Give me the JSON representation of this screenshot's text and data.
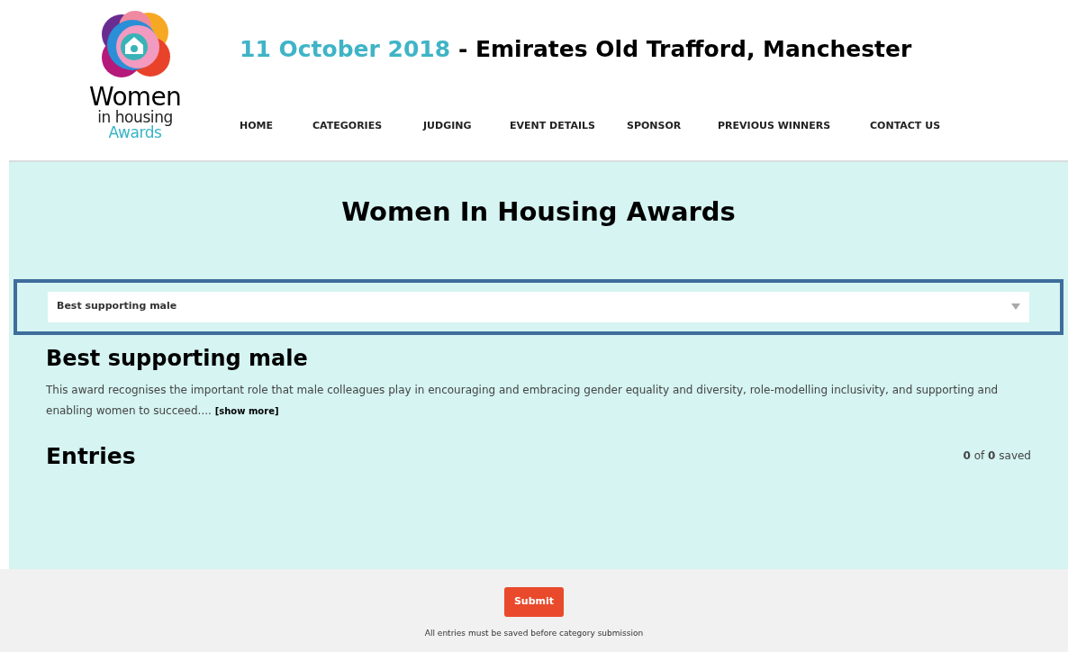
{
  "logo": {
    "line_1": "Women",
    "line_2": "in housing",
    "line_3": "Awards"
  },
  "header": {
    "date": "11 October 2018",
    "venue": "- Emirates Old Trafford, Manchester"
  },
  "nav": [
    {
      "label": "HOME"
    },
    {
      "label": "CATEGORIES"
    },
    {
      "label": "JUDGING"
    },
    {
      "label": "EVENT DETAILS"
    },
    {
      "label": "SPONSOR"
    },
    {
      "label": "PREVIOUS WINNERS"
    },
    {
      "label": "CONTACT US"
    }
  ],
  "page_title": "Women In Housing Awards",
  "category_select": {
    "value": "Best supporting male",
    "highlighted": true
  },
  "category": {
    "title": "Best supporting male",
    "description": "This award recognises the important role that male colleagues play in encouraging and embracing gender equality and diversity, role-modelling inclusivity, and supporting and enabling women to succeed....",
    "show_more": "[show more]"
  },
  "entries": {
    "title": "Entries",
    "saved": "**0** of **0** saved"
  },
  "footer": {
    "submit": "Submit",
    "note": "All entries must be saved before category submission"
  }
}
